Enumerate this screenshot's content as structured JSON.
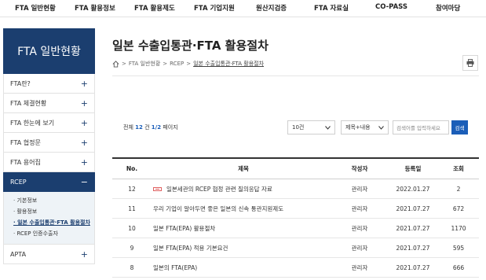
{
  "topnav": {
    "items": [
      "FTA 일반현황",
      "FTA 활용정보",
      "FTA 활용제도",
      "FTA 기업지원",
      "원산지검증",
      "FTA 자료실",
      "CO-PASS",
      "참여마당"
    ]
  },
  "sidebar": {
    "title": "FTA 일반현황",
    "items": [
      {
        "label": "FTA란?",
        "sign": "+"
      },
      {
        "label": "FTA 체결현황",
        "sign": "+"
      },
      {
        "label": "FTA 한눈에 보기",
        "sign": "+"
      },
      {
        "label": "FTA 협정문",
        "sign": "+"
      },
      {
        "label": "FTA 용어집",
        "sign": "+"
      }
    ],
    "active": {
      "label": "RCEP",
      "sign": "−"
    },
    "subitems": [
      "· 기본정보",
      "· 활용정보",
      "· 일본 수출입통관·FTA 활용절차",
      "· RCEP 인증수출자"
    ],
    "after": {
      "label": "APTA",
      "sign": "+"
    }
  },
  "page": {
    "title": "일본 수출입통관·FTA 활용절차",
    "breadcrumb": [
      "FTA 일반현황",
      "RCEP",
      "일본 수출입통관·FTA 활용절차"
    ],
    "breadcrumb_sep": ">"
  },
  "summary": {
    "total_label": "전체",
    "total": "12",
    "unit": "건",
    "page": "1/2",
    "page_label": "페이지"
  },
  "filters": {
    "per_page": "10건",
    "field": "제목+내용",
    "search_placeholder": "검색어를 입력하세요",
    "search_button": "검색"
  },
  "table": {
    "headers": {
      "no": "No.",
      "title": "제목",
      "author": "작성자",
      "date": "등록일",
      "views": "조회"
    },
    "rows": [
      {
        "no": "12",
        "title": "일본세관의 RCEP 협정 관련 질의응답 자료",
        "author": "관리자",
        "date": "2022.01.27",
        "views": "2",
        "attachment": true
      },
      {
        "no": "11",
        "title": "우리 기업이 알아두면 좋은 일본의 신속 통관지원제도",
        "author": "관리자",
        "date": "2021.07.27",
        "views": "672",
        "attachment": false
      },
      {
        "no": "10",
        "title": "일본 FTA(EPA) 활용절차",
        "author": "관리자",
        "date": "2021.07.27",
        "views": "1170",
        "attachment": false
      },
      {
        "no": "9",
        "title": "일본 FTA(EPA) 적용 기본요건",
        "author": "관리자",
        "date": "2021.07.27",
        "views": "595",
        "attachment": false
      },
      {
        "no": "8",
        "title": "일본의 FTA(EPA)",
        "author": "관리자",
        "date": "2021.07.27",
        "views": "666",
        "attachment": false
      }
    ]
  },
  "colors": {
    "primary": "#1b3e6f",
    "accent": "#1b5eb8"
  },
  "icons": {
    "breadcrumb_home": "home-icon",
    "print": "print-icon",
    "dropdown": "chevron-down-icon",
    "attachment": "attachment-icon"
  }
}
